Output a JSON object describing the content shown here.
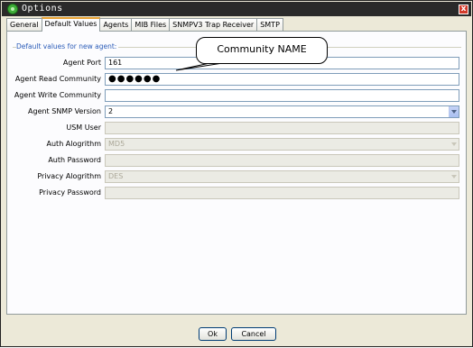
{
  "window": {
    "title": "Options",
    "close_label": "x"
  },
  "tabs": [
    "General",
    "Default Values",
    "Agents",
    "MIB Files",
    "SNMPV3 Trap Receiver",
    "SMTP"
  ],
  "active_tab": "Default Values",
  "group": {
    "legend": "Default values for new agent:"
  },
  "fields": {
    "agent_port": {
      "label": "Agent Port",
      "value": "161"
    },
    "read_community": {
      "label": "Agent Read Community",
      "value": "●●●●●●"
    },
    "write_community": {
      "label": "Agent Write Community",
      "value": ""
    },
    "snmp_version": {
      "label": "Agent SNMP Version",
      "value": "2"
    },
    "usm_user": {
      "label": "USM User",
      "value": ""
    },
    "auth_algorithm": {
      "label": "Auth Alogrithm",
      "value": "MD5"
    },
    "auth_password": {
      "label": "Auth Password",
      "value": ""
    },
    "privacy_algorithm": {
      "label": "Privacy Alogrithm",
      "value": "DES"
    },
    "privacy_password": {
      "label": "Privacy Password",
      "value": ""
    }
  },
  "callout": {
    "text": "Community NAME"
  },
  "buttons": {
    "ok": "Ok",
    "cancel": "Cancel"
  },
  "colors": {
    "titlebar": "#2a2a2a",
    "legend": "#2b5cb8",
    "active_tab_accent": "#e7a133"
  }
}
